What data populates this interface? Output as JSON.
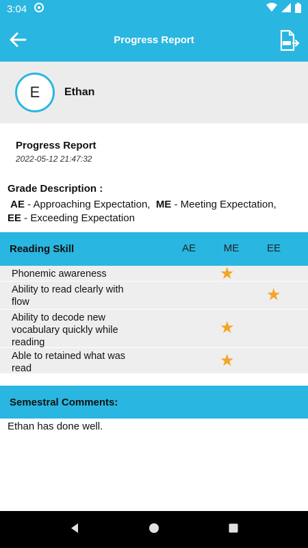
{
  "status_bar": {
    "time": "3:04"
  },
  "app_bar": {
    "title": "Progress Report",
    "back_icon": "arrow-left-icon",
    "pdf_icon": "pdf-export-icon"
  },
  "student": {
    "initial": "E",
    "name": "Ethan"
  },
  "report": {
    "title": "Progress Report",
    "date": "2022-05-12 21:47:32"
  },
  "grade_description": {
    "title": "Grade Description :",
    "line1_ae_code": "AE",
    "line1_ae_text": " - Approaching Expectation,  ",
    "line1_me_code": "ME",
    "line1_me_text": " - Meeting Expectation,",
    "line2_ee_code": "EE",
    "line2_ee_text": " - Exceeding Expectation"
  },
  "reading_skill": {
    "title": "Reading Skill",
    "columns": [
      "AE",
      "ME",
      "EE"
    ],
    "rows": [
      {
        "label": "Phonemic awareness",
        "rating": "ME"
      },
      {
        "label": "Ability to read clearly with flow",
        "rating": "EE"
      },
      {
        "label": "Ability to decode new vocabulary quickly while reading",
        "rating": "ME"
      },
      {
        "label": "Able to retained what was read",
        "rating": "ME"
      }
    ]
  },
  "comments": {
    "title": "Semestral Comments:",
    "text": "Ethan has done well."
  },
  "colors": {
    "accent": "#29b6e0",
    "star": "#f4a522",
    "row_bg": "#eeeeee"
  }
}
